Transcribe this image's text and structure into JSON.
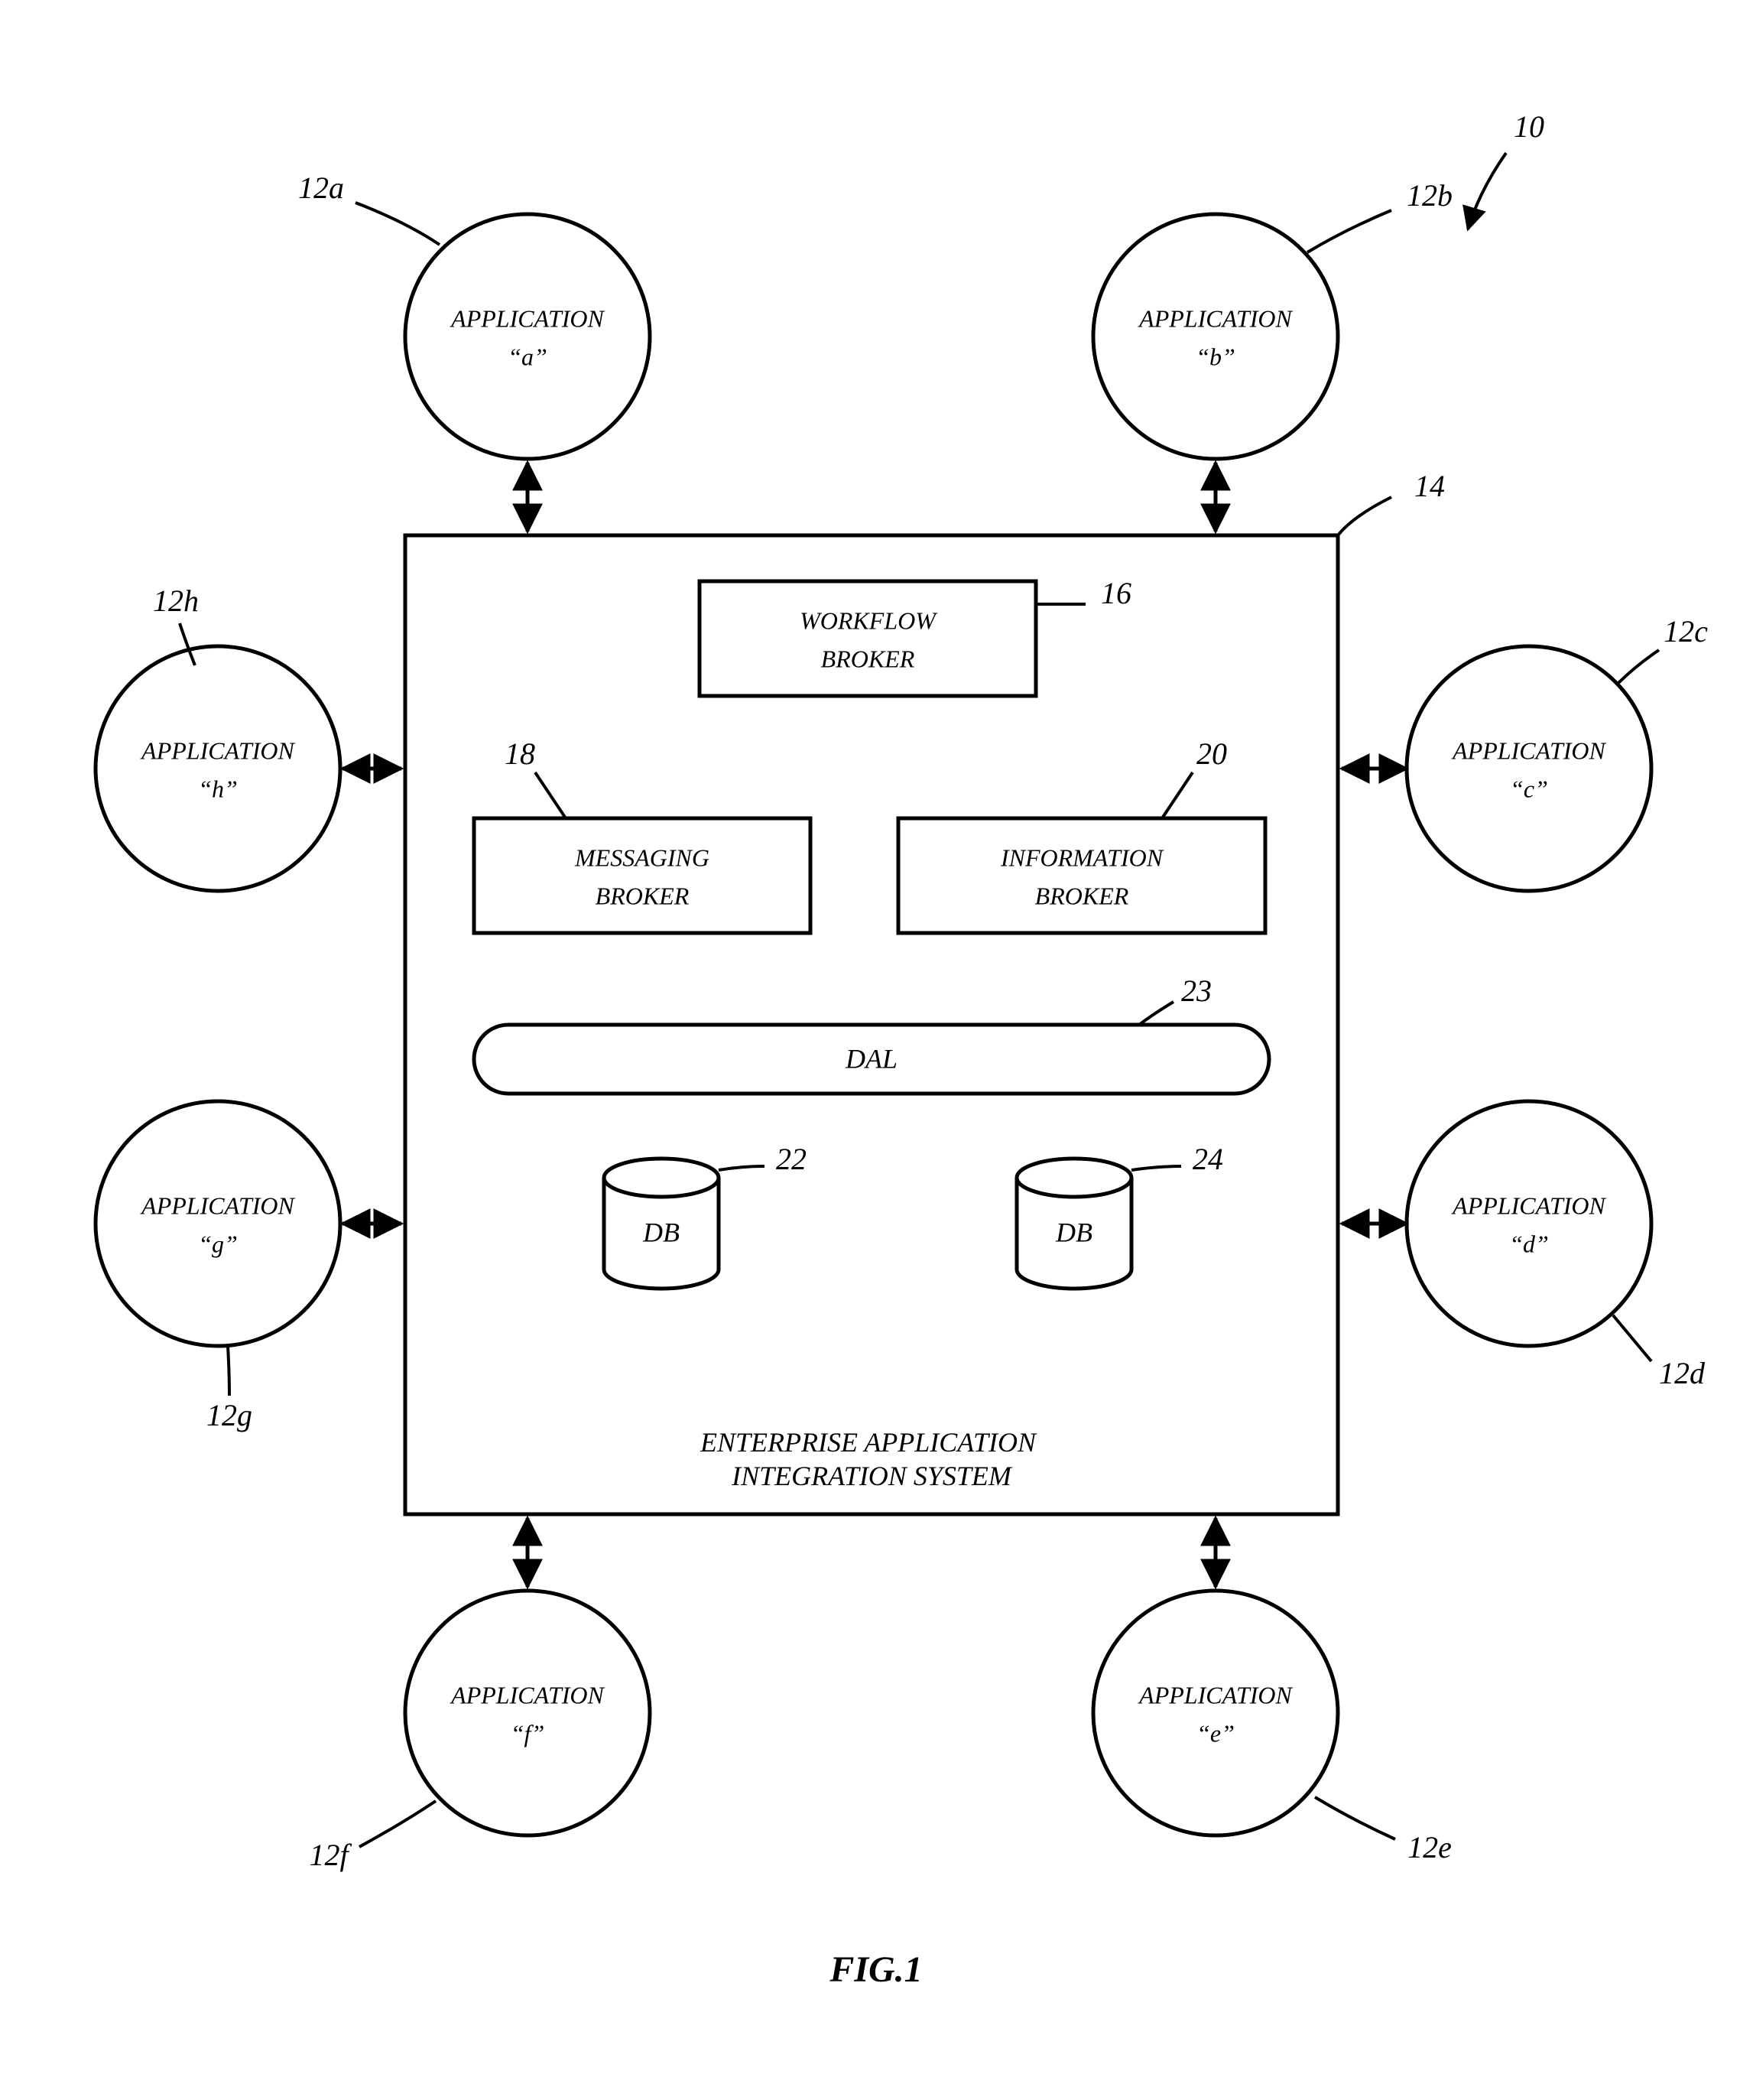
{
  "figure_ref": "10",
  "caption": "FIG.1",
  "system": {
    "title": "ENTERPRISE APPLICATION INTEGRATION SYSTEM",
    "ref": "14",
    "workflow": {
      "label1": "WORKFLOW",
      "label2": "BROKER",
      "ref": "16"
    },
    "messaging": {
      "label1": "MESSAGING",
      "label2": "BROKER",
      "ref": "18"
    },
    "information": {
      "label1": "INFORMATION",
      "label2": "BROKER",
      "ref": "20"
    },
    "dal": {
      "label": "DAL",
      "ref": "23"
    },
    "db1": {
      "label": "DB",
      "ref": "22"
    },
    "db2": {
      "label": "DB",
      "ref": "24"
    }
  },
  "apps": {
    "a": {
      "label1": "APPLICATION",
      "label2": "“a”",
      "ref": "12a"
    },
    "b": {
      "label1": "APPLICATION",
      "label2": "“b”",
      "ref": "12b"
    },
    "c": {
      "label1": "APPLICATION",
      "label2": "“c”",
      "ref": "12c"
    },
    "d": {
      "label1": "APPLICATION",
      "label2": "“d”",
      "ref": "12d"
    },
    "e": {
      "label1": "APPLICATION",
      "label2": "“e”",
      "ref": "12e"
    },
    "f": {
      "label1": "APPLICATION",
      "label2": "“f”",
      "ref": "12f"
    },
    "g": {
      "label1": "APPLICATION",
      "label2": "“g”",
      "ref": "12g"
    },
    "h": {
      "label1": "APPLICATION",
      "label2": "“h”",
      "ref": "12h"
    }
  }
}
